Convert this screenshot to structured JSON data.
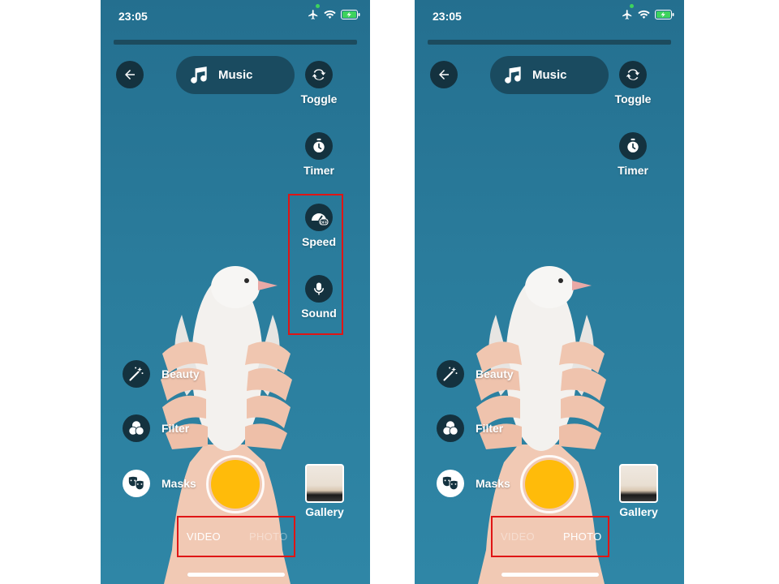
{
  "colors": {
    "background": "#2a7c9c",
    "shutter": "#ffbb0a",
    "icon_circle": "#14323f",
    "highlight": "#e01515"
  },
  "screens": [
    {
      "status": {
        "time": "23:05",
        "icons": [
          "airplane-icon",
          "wifi-icon",
          "battery-charging-icon"
        ]
      },
      "back_icon": "back-arrow-icon",
      "music": {
        "label": "Music",
        "icon": "music-note-icon"
      },
      "right_tools": [
        {
          "label": "Toggle",
          "icon": "camera-flip-icon"
        },
        {
          "label": "Timer",
          "icon": "timer-icon"
        },
        {
          "label": "Speed",
          "icon": "speed-off-icon"
        },
        {
          "label": "Sound",
          "icon": "microphone-icon"
        }
      ],
      "left_tools": [
        {
          "label": "Beauty",
          "icon": "magic-wand-icon"
        },
        {
          "label": "Filter",
          "icon": "filter-circles-icon"
        },
        {
          "label": "Masks",
          "icon": "theater-masks-icon"
        }
      ],
      "gallery_label": "Gallery",
      "modes": {
        "video": "VIDEO",
        "photo": "PHOTO",
        "selected": "VIDEO"
      }
    },
    {
      "status": {
        "time": "23:05",
        "icons": [
          "airplane-icon",
          "wifi-icon",
          "battery-charging-icon"
        ]
      },
      "back_icon": "back-arrow-icon",
      "music": {
        "label": "Music",
        "icon": "music-note-icon"
      },
      "right_tools": [
        {
          "label": "Toggle",
          "icon": "camera-flip-icon"
        },
        {
          "label": "Timer",
          "icon": "timer-icon"
        }
      ],
      "left_tools": [
        {
          "label": "Beauty",
          "icon": "magic-wand-icon"
        },
        {
          "label": "Filter",
          "icon": "filter-circles-icon"
        },
        {
          "label": "Masks",
          "icon": "theater-masks-icon"
        }
      ],
      "gallery_label": "Gallery",
      "modes": {
        "video": "VIDEO",
        "photo": "PHOTO",
        "selected": "PHOTO"
      }
    }
  ]
}
